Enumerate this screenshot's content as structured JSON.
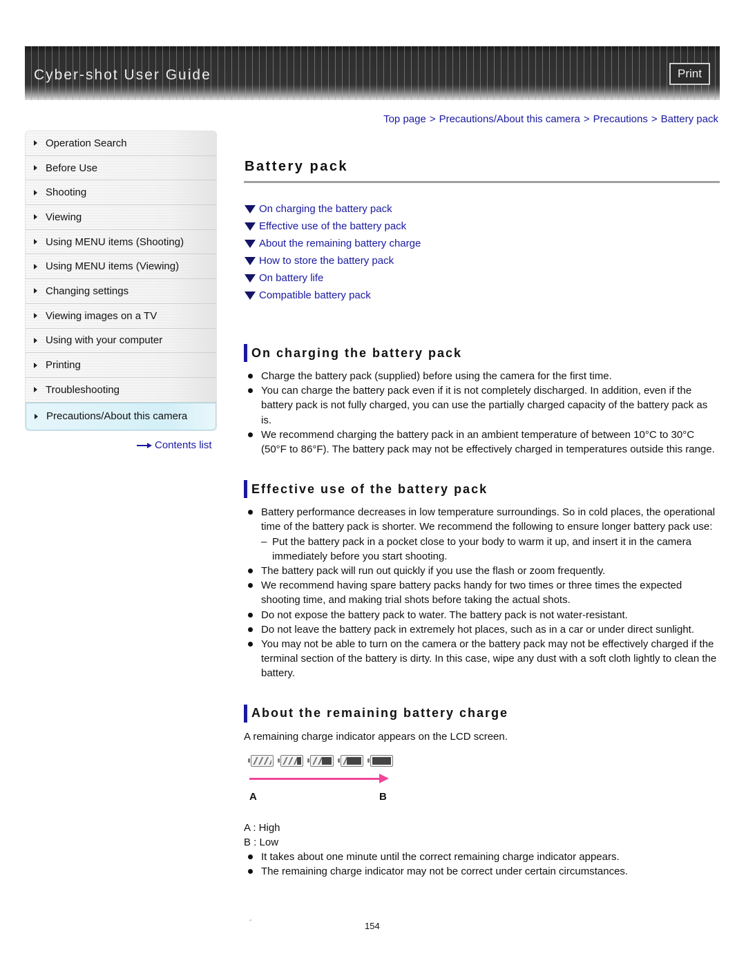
{
  "header": {
    "title": "Cyber-shot User Guide",
    "print_label": "Print",
    "print_icon": "print-button"
  },
  "breadcrumb": {
    "items": [
      "Top page",
      "Precautions/About this camera",
      "Precautions",
      "Battery pack"
    ],
    "separator": ">"
  },
  "sidebar": {
    "items": [
      {
        "label": "Operation Search",
        "active": false
      },
      {
        "label": "Before Use",
        "active": false
      },
      {
        "label": "Shooting",
        "active": false
      },
      {
        "label": "Viewing",
        "active": false
      },
      {
        "label": "Using MENU items (Shooting)",
        "active": false
      },
      {
        "label": "Using MENU items (Viewing)",
        "active": false
      },
      {
        "label": "Changing settings",
        "active": false
      },
      {
        "label": "Viewing images on a TV",
        "active": false
      },
      {
        "label": "Using with your computer",
        "active": false
      },
      {
        "label": "Printing",
        "active": false
      },
      {
        "label": "Troubleshooting",
        "active": false
      },
      {
        "label": "Precautions/About this camera",
        "active": true
      }
    ],
    "contents_link": "Contents list",
    "arrow_icon": "right-arrow-icon"
  },
  "main": {
    "title": "Battery pack",
    "toc": [
      "On charging the battery pack",
      "Effective use of the battery pack",
      "About the remaining battery charge",
      "How to store the battery pack",
      "On battery life",
      "Compatible battery pack"
    ],
    "sections": [
      {
        "heading": "On charging the battery pack",
        "bullets": [
          "Charge the battery pack (supplied) before using the camera for the first time.",
          "You can charge the battery pack even if it is not completely discharged. In addition, even if the battery pack is not fully charged, you can use the partially charged capacity of the battery pack as is.",
          "We recommend charging the battery pack in an ambient temperature of between 10°C to 30°C (50°F to 86°F). The battery pack may not be effectively charged in temperatures outside this range."
        ]
      },
      {
        "heading": "Effective use of the battery pack",
        "bullets": [
          "Battery performance decreases in low temperature surroundings. So in cold places, the operational time of the battery pack is shorter. We recommend the following to ensure longer battery pack use:",
          "Put the battery pack in a pocket close to your body to warm it up, and insert it in the camera immediately before you start shooting.",
          "The battery pack will run out quickly if you use the flash or zoom frequently.",
          "We recommend having spare battery packs handy for two times or three times the expected shooting time, and making trial shots before taking the actual shots.",
          "Do not expose the battery pack to water. The battery pack is not water-resistant.",
          "Do not leave the battery pack in extremely hot places, such as in a car or under direct sunlight.",
          "You may not be able to turn on the camera or the battery pack may not be effectively charged if the terminal section of the battery is dirty. In this case, wipe any dust with a soft cloth lightly to clean the battery."
        ],
        "sub_dash": "–"
      },
      {
        "heading": "About the remaining battery charge",
        "intro": "A remaining charge indicator appears on the LCD screen.",
        "figure": {
          "label_a": "A",
          "label_b": "B",
          "indicator_levels": [
            1.0,
            0.75,
            0.5,
            0.25,
            0.0
          ]
        },
        "legend": [
          "A : High",
          "B : Low"
        ],
        "bullets": [
          "It takes about one minute until the correct remaining charge indicator appears.",
          "The remaining charge indicator may not be correct under certain circumstances."
        ]
      }
    ]
  },
  "footer": {
    "page_number": "154",
    "stray_mark": "-"
  }
}
